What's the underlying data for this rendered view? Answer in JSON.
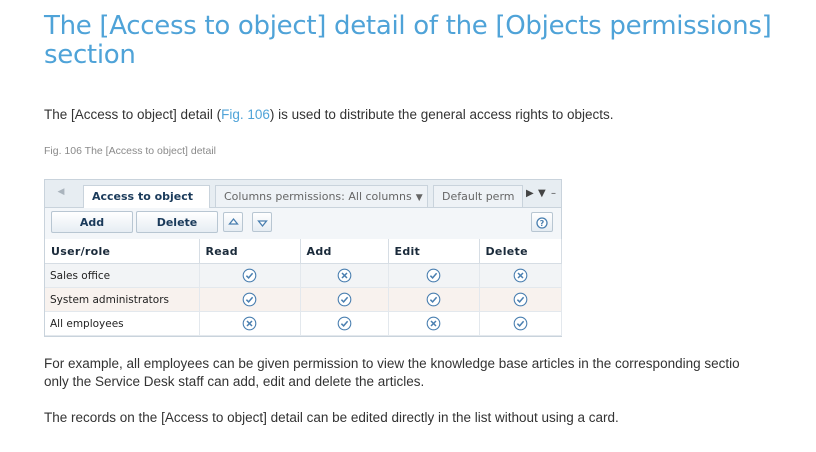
{
  "title": "The [Access to object] detail of the [Objects permissions] section",
  "intro": {
    "before": "The [Access to object] detail (",
    "link": "Fig. 106",
    "after": ") is used to distribute the general access rights to objects."
  },
  "caption": "Fig.  106  The [Access to object] detail",
  "figure": {
    "tabs": {
      "active": "Access to object",
      "columns": "Columns permissions:  All columns",
      "default": "Default perm"
    },
    "toolbar": {
      "add_label": "Add",
      "delete_label": "Delete"
    },
    "headers": [
      "User/role",
      "Read",
      "Add",
      "Edit",
      "Delete"
    ],
    "rows": [
      {
        "name": "Sales office",
        "read": "check",
        "add": "cross",
        "edit": "check",
        "delete": "cross"
      },
      {
        "name": "System administrators",
        "read": "check",
        "add": "check",
        "edit": "check",
        "delete": "check"
      },
      {
        "name": "All employees",
        "read": "cross",
        "add": "check",
        "edit": "cross",
        "delete": "check"
      }
    ]
  },
  "para2": {
    "line1": "For example, all employees can be given permission to view the knowledge base articles in the corresponding sectio",
    "line2": "only the Service Desk staff can add, edit and delete the articles."
  },
  "para3": "The records on the [Access to object] detail can be edited directly in the list without using a card.",
  "colors": {
    "accent": "#4fa3d8",
    "mark": "#4a7fb0"
  }
}
